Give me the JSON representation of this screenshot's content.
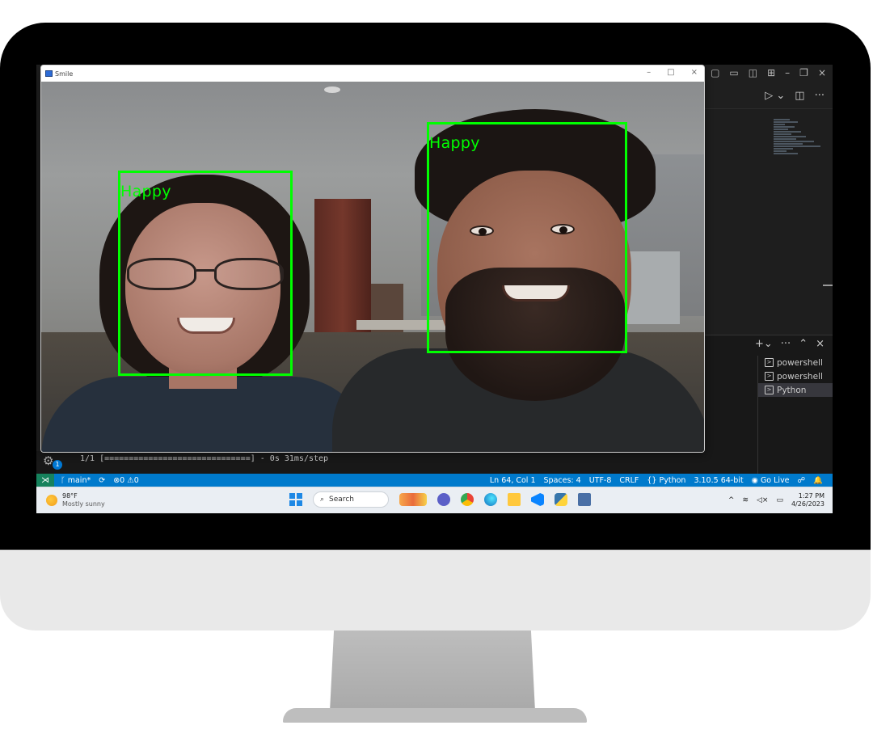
{
  "camera_window": {
    "title": "Smile",
    "minimize_glyph": "–",
    "maximize_glyph": "□",
    "close_glyph": "×",
    "detections": [
      {
        "label": "Happy"
      },
      {
        "label": "Happy"
      }
    ]
  },
  "terminal": {
    "output_line": "1/1 [==============================] - 0s 31ms/step",
    "items": [
      {
        "label": "powershell"
      },
      {
        "label": "powershell"
      },
      {
        "label": "Python"
      }
    ],
    "badge_count": "1"
  },
  "status_bar": {
    "branch": "main*",
    "errors": "0",
    "warnings": "0",
    "position": "Ln 64, Col 1",
    "spaces": "Spaces: 4",
    "encoding": "UTF-8",
    "eol": "CRLF",
    "language": "Python",
    "interpreter": "3.10.5 64-bit",
    "go_live": "Go Live"
  },
  "taskbar": {
    "weather_temp": "98°F",
    "weather_desc": "Mostly sunny",
    "search_label": "Search",
    "time": "1:27 PM",
    "date": "4/26/2023"
  },
  "colors": {
    "detection_box": "#00ff00",
    "status_bar": "#007acc",
    "monitor_bezel": "#000000",
    "monitor_chin": "#e9e9e9"
  }
}
